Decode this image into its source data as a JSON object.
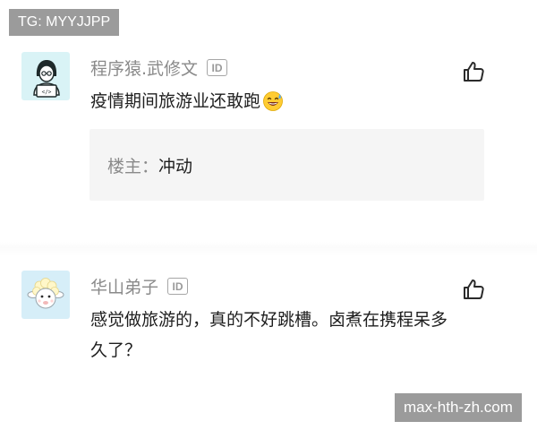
{
  "watermarks": {
    "top": "TG: MYYJJPP",
    "bottom": "max-hth-zh.com"
  },
  "comments": [
    {
      "username": "程序猿.武修文",
      "id_badge": "ID",
      "text": "疫情期间旅游业还敢跑",
      "emoji": "grinning-sweat-emoji",
      "quote": {
        "label": "楼主：",
        "text": "冲动"
      },
      "avatar": "programmer-avatar",
      "like_icon": "thumbs-up-icon"
    },
    {
      "username": "华山弟子",
      "id_badge": "ID",
      "text": "感觉做旅游的，真的不好跳槽。卤煮在携程呆多久了？",
      "avatar": "sheep-avatar",
      "like_icon": "thumbs-up-icon"
    }
  ],
  "colors": {
    "watermark_bg": "#9b9b9b",
    "username": "#8a8a8a",
    "quote_bg": "#f5f5f5",
    "avatar1_bg": "#d9f3f6",
    "avatar2_bg": "#d6eef8"
  }
}
